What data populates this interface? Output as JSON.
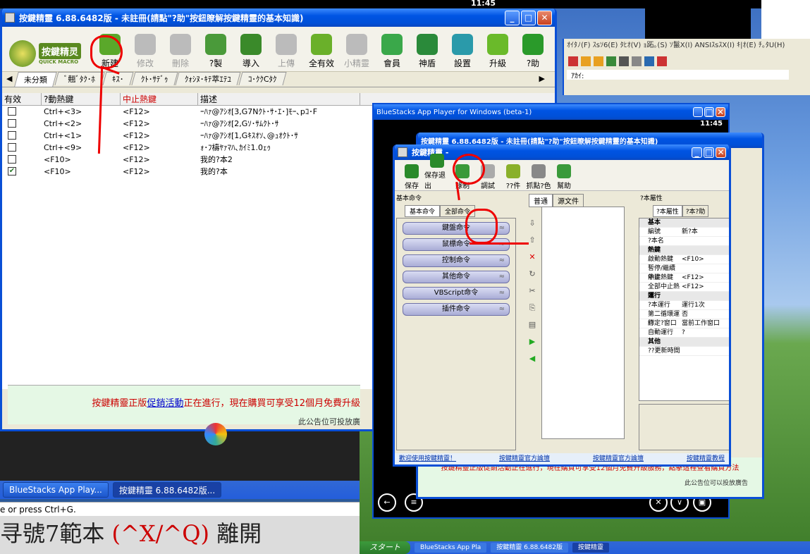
{
  "top_clock": "11:45",
  "main_window": {
    "title": "按鍵精靈 6.88.6482版 - 未註冊(請點\"?助\"按鈕瞭解按鍵精靈的基本知識)",
    "logo_text": "按鍵精灵",
    "logo_sub": "QUICK MACRO",
    "toolbar": [
      {
        "label": "新建",
        "icon": "new-script-icon",
        "enabled": true,
        "color": "#5aa82a"
      },
      {
        "label": "修改",
        "icon": "edit-icon",
        "enabled": false,
        "color": "#bbbbbb"
      },
      {
        "label": "刪除",
        "icon": "trash-icon",
        "enabled": false,
        "color": "#bbbbbb"
      },
      {
        "label": "?製",
        "icon": "camera-icon",
        "enabled": true,
        "color": "#4a9a3a"
      },
      {
        "label": "導入",
        "icon": "import-icon",
        "enabled": true,
        "color": "#3a8a2a"
      },
      {
        "label": "上傳",
        "icon": "upload-icon",
        "enabled": false,
        "color": "#bbbbbb"
      },
      {
        "label": "全有效",
        "icon": "diamond-icon",
        "enabled": true,
        "color": "#6ab02a"
      },
      {
        "label": "小精靈",
        "icon": "elf-icon",
        "enabled": false,
        "color": "#bbbbbb"
      },
      {
        "label": "會員",
        "icon": "member-icon",
        "enabled": true,
        "color": "#3aa84a"
      },
      {
        "label": "神盾",
        "icon": "shield-icon",
        "enabled": true,
        "color": "#2a8a3a"
      },
      {
        "label": "設置",
        "icon": "settings-icon",
        "enabled": true,
        "color": "#2a9aaa"
      },
      {
        "label": "升級",
        "icon": "upgrade-icon",
        "enabled": true,
        "color": "#6aba2a"
      },
      {
        "label": "?助",
        "icon": "help-icon",
        "enabled": true,
        "color": "#2a9a2a"
      }
    ],
    "tabs": [
      "未分類",
      "ﾞ翹ﾞﾀｸ･ﾎ",
      "ｷｽ･",
      "ｸﾄ･ｻﾃﾞｩ",
      "ｸｫｼﾇ･ｷﾃ萃ｴﾃﾕ",
      "ｺ･ｸｸCﾀｸ"
    ],
    "columns": [
      "有效",
      "?動熱鍵",
      "中止熱鍵",
      "描述"
    ],
    "rows": [
      {
        "checked": false,
        "hotkey": "Ctrl+<3>",
        "stop": "<F12>",
        "desc": "ｰﾊｧ@ｱｼｵ[3,G7Nｸﾄ･ｻ･ｴ･]ﾓｰ､pｺ･F"
      },
      {
        "checked": false,
        "hotkey": "Ctrl+<2>",
        "stop": "<F12>",
        "desc": "ｰﾊｧ@ｱｼｵ[2,Gｿ･ｻﾑｸﾄ･ｻ"
      },
      {
        "checked": false,
        "hotkey": "Ctrl+<1>",
        "stop": "<F12>",
        "desc": "ｰﾊｧ@ｱｼｵ[1,Gｷｽｵｿ､@ｭｵｸﾄ･ｻ"
      },
      {
        "checked": false,
        "hotkey": "Ctrl+<9>",
        "stop": "<F12>",
        "desc": "ｫ･ﾌ檮ﾔｧﾏﾊ､ｶｲﾐ1.0ｪｩ"
      },
      {
        "checked": false,
        "hotkey": "<F10>",
        "stop": "<F12>",
        "desc": "我的?本2"
      },
      {
        "checked": true,
        "hotkey": "<F10>",
        "stop": "<F12>",
        "desc": "我的?本"
      }
    ],
    "ad_part1": "按鍵精靈正版",
    "ad_link": "促銷活動",
    "ad_part2": "正在進行，現在購買可享受12個月免費升級",
    "ad_sub": "此公告位可投放廣"
  },
  "taskbar": {
    "items": [
      "BlueStacks App Play...",
      "按鍵精靈 6.88.6482版..."
    ]
  },
  "status_text": "e or press Ctrl+G.",
  "big_text": {
    "a": "寻號7範本",
    "b": "(^X/^Q)",
    "c": "離開"
  },
  "edit_window": {
    "menu": "ｵｲﾀﾉ(F)  ｽsｿ6(E)  ﾀﾋｵ(V)  ｮ跖｡(S)  ｿ鬣X(I)  ANSIｽsｽX(I)  ｷ|ｵ(E)  ﾁ｡ﾀU(H)",
    "address": "ｱｶｲ:"
  },
  "bluestacks": {
    "title": "BlueStacks App Player for Windows (beta-1)",
    "clock": "11:45"
  },
  "inner_editor": {
    "title": "按鍵精靈 -",
    "bg_title": "按鍵精靈 6.88.6482版 - 未註冊(請點\"?助\"按鈕瞭解按鍵精靈的基本知識)",
    "toolbar": [
      "保存",
      "保存退出",
      "錄制",
      "調試",
      "??件",
      "抓點?色",
      "幫助"
    ],
    "left_header": "基本命令",
    "left_tabs": [
      "基本命令",
      "全部命令"
    ],
    "commands": [
      "鍵盤命令",
      "鼠標命令",
      "控制命令",
      "其他命令",
      "VBScript命令",
      "插件命令"
    ],
    "center_tabs": [
      "普通",
      "源文件"
    ],
    "right_header": "?本屬性",
    "right_tabs": [
      "?本屬性",
      "?本?助"
    ],
    "props": [
      {
        "section": true,
        "k": "基本",
        "v": ""
      },
      {
        "section": false,
        "k": "編號",
        "v": "新?本"
      },
      {
        "section": false,
        "k": "?本名",
        "v": ""
      },
      {
        "section": true,
        "k": "熱鍵",
        "v": ""
      },
      {
        "section": false,
        "k": "啟動熱鍵",
        "v": "<F10>"
      },
      {
        "section": false,
        "k": "暫停/繼續熱鍵",
        "v": ""
      },
      {
        "section": false,
        "k": "中止熱鍵",
        "v": "<F12>"
      },
      {
        "section": false,
        "k": "全部中止熱鍵",
        "v": "<F12>"
      },
      {
        "section": true,
        "k": "運行",
        "v": ""
      },
      {
        "section": false,
        "k": "?本運行",
        "v": "運行1次"
      },
      {
        "section": false,
        "k": "第二循環運行",
        "v": "否"
      },
      {
        "section": false,
        "k": "綁定?窗口",
        "v": "當前工作窗口"
      },
      {
        "section": false,
        "k": "自動運行",
        "v": "?"
      },
      {
        "section": true,
        "k": "其他",
        "v": ""
      },
      {
        "section": false,
        "k": "??更新時間",
        "v": ""
      }
    ],
    "footer_links": [
      "歡迎使用按鍵精靈！",
      "按鍵精靈官方論壇",
      "按鍵精靈官方論壇",
      "按鍵精靈教程"
    ],
    "ad_text": "按鍵精靈正版促銷活動正在進行，現在購買可享受12個月免費升級服務，點擊這裡查看購買方法",
    "ad_sub": "此公告位可以投放廣告"
  },
  "bottom_taskbar": {
    "start": "スタート",
    "items": [
      "BlueStacks App Pla",
      "按鍵精靈 6.88.6482版",
      "按鍵精靈"
    ]
  },
  "colors": {
    "xp_blue": "#0054e3",
    "ad_bg": "#e5f8e5",
    "annotation_red": "#e00000"
  }
}
